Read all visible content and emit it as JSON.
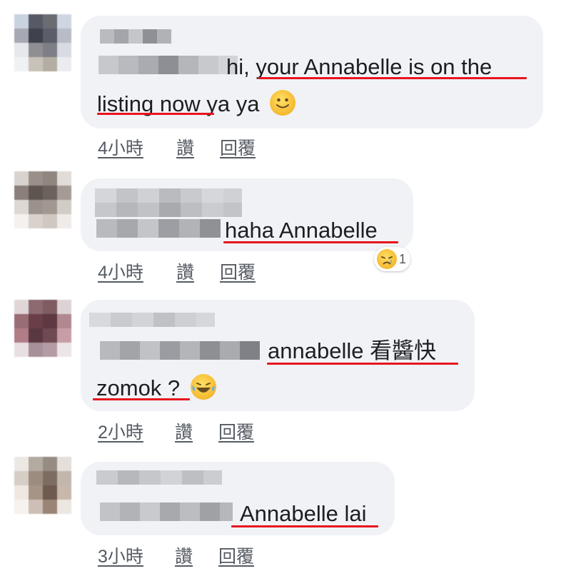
{
  "comments": [
    {
      "text_lines": [
        "hi, your Annabelle is on the",
        "listing now ya"
      ],
      "emoji": "slightly-smiling-face-icon",
      "time": "4小時",
      "like": "讚",
      "reply": "回覆"
    },
    {
      "text_lines": [
        "haha Annabelle"
      ],
      "time": "4小時",
      "like": "讚",
      "reply": "回覆",
      "reaction": {
        "icon": "sad-tear-face-icon",
        "count": "1"
      }
    },
    {
      "text_lines": [
        "annabelle 看醬快",
        "zomok ?"
      ],
      "emoji": "laughing-tears-face-icon",
      "time": "2小時",
      "like": "讚",
      "reply": "回覆"
    },
    {
      "text_lines": [
        "Annabelle lai"
      ],
      "time": "3小時",
      "like": "讚",
      "reply": "回覆"
    }
  ],
  "colors": {
    "bubble": "#f0f2f5",
    "underline": "#e8141e",
    "meta": "#555b63"
  }
}
